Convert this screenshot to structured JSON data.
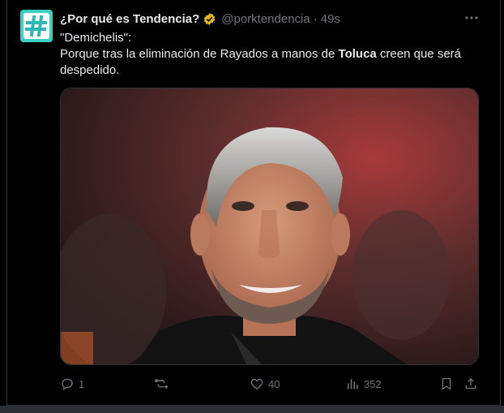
{
  "tweet": {
    "author_name": "¿Por qué es Tendencia?",
    "handle": "@porktendencia",
    "separator": "·",
    "time": "49s",
    "text_line1": "\"Demichelis\":",
    "text_pre": "Porque tras la eliminación de Rayados a manos de ",
    "text_bold": "Toluca",
    "text_post": " creen que será despedido.",
    "avatar_symbol": "#",
    "colors": {
      "avatar_bg": "#3ccfc3",
      "verified": "#e2b719",
      "muted": "#71767b"
    }
  },
  "actions": {
    "reply_count": "1",
    "retweet_count": "",
    "like_count": "40",
    "views_count": "352"
  },
  "icons": [
    "hashtag-icon",
    "verified-badge-icon",
    "more-icon",
    "reply-icon",
    "retweet-icon",
    "like-icon",
    "views-icon",
    "bookmark-icon",
    "share-icon"
  ]
}
